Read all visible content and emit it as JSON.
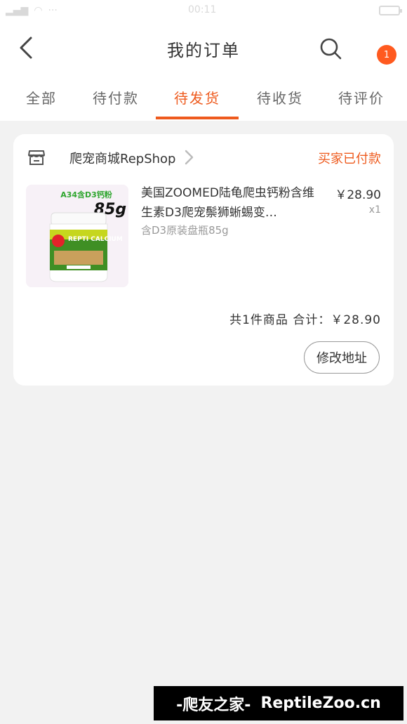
{
  "status_bar": {
    "time": "00:11"
  },
  "header": {
    "title": "我的订单",
    "badge_count": "1"
  },
  "tabs": [
    {
      "label": "全部"
    },
    {
      "label": "待付款"
    },
    {
      "label": "待发货"
    },
    {
      "label": "待收货"
    },
    {
      "label": "待评价"
    }
  ],
  "active_tab": "待发货",
  "order": {
    "shop_name": "爬宠商城RepShop",
    "status": "买家已付款",
    "product": {
      "image_labels": {
        "top": "A34含D3钙粉",
        "weight": "85g",
        "brand": "REPTI CALCIUM"
      },
      "title": "美国ZOOMED陆龟爬虫钙粉含维生素D3爬宠鬃狮蜥蜴变…",
      "spec": "含D3原装盘瓶85g",
      "price": "￥28.90",
      "quantity": "x1"
    },
    "summary": "共1件商品  合计：￥28.90",
    "edit_address_label": "修改地址"
  },
  "watermark": {
    "left": "-爬友之家-",
    "right": "ReptileZoo.cn"
  },
  "colors": {
    "accent": "#ee5a1d",
    "badge": "#ff5a1f",
    "background": "#f2f2f2"
  },
  "icons": [
    "back-arrow-icon",
    "search-icon",
    "more-icon",
    "shop-icon",
    "chevron-right-icon"
  ]
}
